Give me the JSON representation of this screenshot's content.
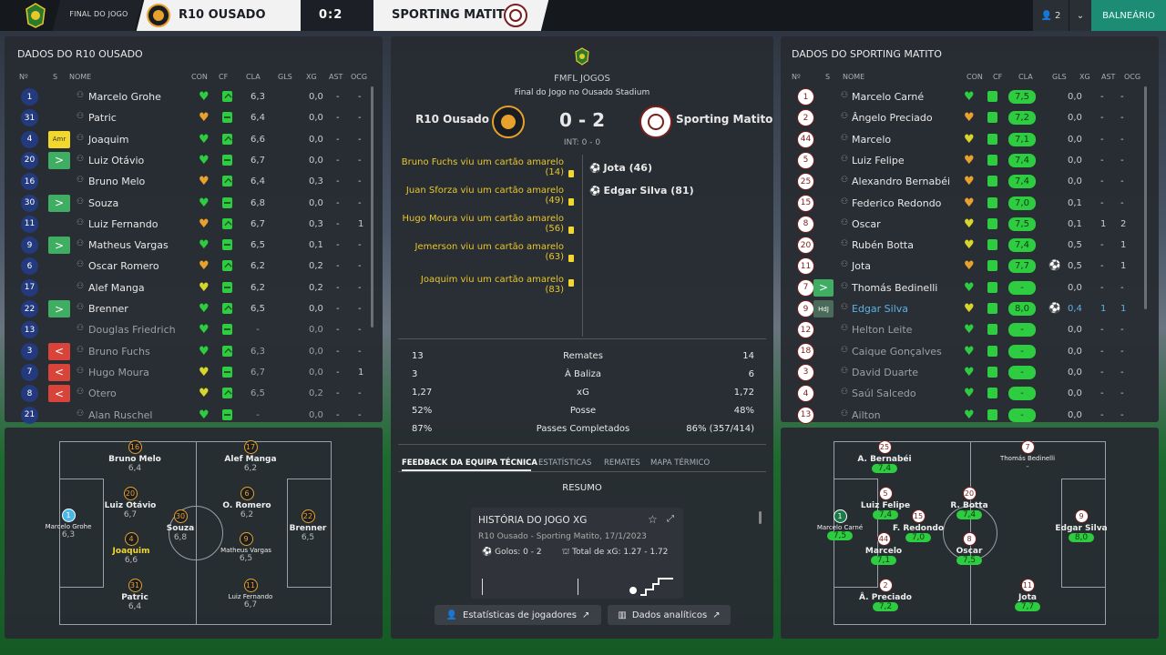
{
  "topbar": {
    "stage": "FINAL DO JOGO",
    "home": "R10 OUSADO",
    "score": "0:2",
    "away": "SPORTING MATITO",
    "users": "2",
    "right_button": "BALNEÁRIO"
  },
  "left": {
    "title": "DADOS DO R10 OUSADO",
    "headers": [
      "Nº",
      "S",
      "NOME",
      "CON",
      "CF",
      "CLA",
      "GLS",
      "XG",
      "AST",
      "OCG"
    ],
    "rows": [
      {
        "num": "1",
        "sub": "",
        "name": "Marcelo Grohe",
        "cla": "6,3",
        "xg": "0,0",
        "ast": "-",
        "ocg": "-"
      },
      {
        "num": "31",
        "sub": "",
        "name": "Patric",
        "cla": "6,4",
        "xg": "0,0",
        "ast": "-",
        "ocg": "-"
      },
      {
        "num": "4",
        "sub": "Amr",
        "name": "Joaquim",
        "cla": "6,6",
        "xg": "0,0",
        "ast": "-",
        "ocg": "-"
      },
      {
        "num": "20",
        "sub": ">",
        "name": "Luiz Otávio",
        "cla": "6,7",
        "xg": "0,0",
        "ast": "-",
        "ocg": "-"
      },
      {
        "num": "16",
        "sub": "",
        "name": "Bruno Melo",
        "cla": "6,4",
        "xg": "0,3",
        "ast": "-",
        "ocg": "-"
      },
      {
        "num": "30",
        "sub": ">",
        "name": "Souza",
        "cla": "6,8",
        "xg": "0,0",
        "ast": "-",
        "ocg": "-"
      },
      {
        "num": "11",
        "sub": "",
        "name": "Luiz Fernando",
        "cla": "6,7",
        "xg": "0,3",
        "ast": "-",
        "ocg": "1"
      },
      {
        "num": "9",
        "sub": ">",
        "name": "Matheus Vargas",
        "cla": "6,5",
        "xg": "0,1",
        "ast": "-",
        "ocg": "-"
      },
      {
        "num": "6",
        "sub": "",
        "name": "Oscar Romero",
        "cla": "6,2",
        "xg": "0,2",
        "ast": "-",
        "ocg": "-"
      },
      {
        "num": "17",
        "sub": "",
        "name": "Alef Manga",
        "cla": "6,2",
        "xg": "0,2",
        "ast": "-",
        "ocg": "-"
      },
      {
        "num": "22",
        "sub": ">",
        "name": "Brenner",
        "cla": "6,5",
        "xg": "0,0",
        "ast": "-",
        "ocg": "-"
      },
      {
        "num": "13",
        "sub": "",
        "name": "Douglas Friedrich",
        "cla": "-",
        "xg": "0,0",
        "ast": "-",
        "ocg": "-"
      },
      {
        "num": "3",
        "sub": "<",
        "name": "Bruno Fuchs",
        "cla": "6,3",
        "xg": "0,0",
        "ast": "-",
        "ocg": "-"
      },
      {
        "num": "7",
        "sub": "<",
        "name": "Hugo Moura",
        "cla": "6,7",
        "xg": "0,0",
        "ast": "-",
        "ocg": "1"
      },
      {
        "num": "8",
        "sub": "<",
        "name": "Otero",
        "cla": "6,5",
        "xg": "0,2",
        "ast": "-",
        "ocg": "-"
      },
      {
        "num": "21",
        "sub": "",
        "name": "Alan Ruschel",
        "cla": "-",
        "xg": "0,0",
        "ast": "-",
        "ocg": "-"
      }
    ],
    "pitch": [
      {
        "num": "1",
        "name": "Marcelo Grohe",
        "rating": "6,3"
      },
      {
        "num": "16",
        "name": "Bruno Melo",
        "rating": "6,4"
      },
      {
        "num": "17",
        "name": "Alef Manga",
        "rating": "6,2"
      },
      {
        "num": "20",
        "name": "Luiz Otávio",
        "rating": "6,7"
      },
      {
        "num": "6",
        "name": "O. Romero",
        "rating": "6,2"
      },
      {
        "num": "30",
        "name": "Souza",
        "rating": "6,8"
      },
      {
        "num": "22",
        "name": "Brenner",
        "rating": "6,5"
      },
      {
        "num": "4",
        "name": "Joaquim",
        "rating": "6,6"
      },
      {
        "num": "9",
        "name": "Matheus Vargas",
        "rating": "6,5"
      },
      {
        "num": "31",
        "name": "Patric",
        "rating": "6,4"
      },
      {
        "num": "11",
        "name": "Luiz Fernando",
        "rating": "6,7"
      }
    ]
  },
  "right": {
    "title": "DADOS DO SPORTING MATITO",
    "headers": [
      "Nº",
      "S",
      "NOME",
      "CON",
      "CF",
      "CLA",
      "GLS",
      "XG",
      "AST",
      "OCG"
    ],
    "rows": [
      {
        "num": "1",
        "sub": "",
        "name": "Marcelo Carné",
        "cla": "7,5",
        "goal": "",
        "xg": "0,0",
        "ast": "-",
        "ocg": "-"
      },
      {
        "num": "2",
        "sub": "",
        "name": "Ângelo Preciado",
        "cla": "7,2",
        "goal": "",
        "xg": "0,0",
        "ast": "-",
        "ocg": "-"
      },
      {
        "num": "44",
        "sub": "",
        "name": "Marcelo",
        "cla": "7,1",
        "goal": "",
        "xg": "0,0",
        "ast": "-",
        "ocg": "-"
      },
      {
        "num": "5",
        "sub": "",
        "name": "Luiz Felipe",
        "cla": "7,4",
        "goal": "",
        "xg": "0,0",
        "ast": "-",
        "ocg": "-"
      },
      {
        "num": "25",
        "sub": "",
        "name": "Alexandro Bernabéi",
        "cla": "7,4",
        "goal": "",
        "xg": "0,0",
        "ast": "-",
        "ocg": "-"
      },
      {
        "num": "15",
        "sub": "",
        "name": "Federico Redondo",
        "cla": "7,0",
        "goal": "",
        "xg": "0,1",
        "ast": "-",
        "ocg": "-"
      },
      {
        "num": "8",
        "sub": "",
        "name": "Oscar",
        "cla": "7,5",
        "goal": "",
        "xg": "0,1",
        "ast": "1",
        "ocg": "2"
      },
      {
        "num": "20",
        "sub": "",
        "name": "Rubén Botta",
        "cla": "7,4",
        "goal": "",
        "xg": "0,5",
        "ast": "-",
        "ocg": "1"
      },
      {
        "num": "11",
        "sub": "",
        "name": "Jota",
        "cla": "7,7",
        "goal": "⚽",
        "xg": "0,5",
        "ast": "-",
        "ocg": "1"
      },
      {
        "num": "7",
        "sub": ">",
        "name": "Thomás Bedinelli",
        "cla": "-",
        "goal": "",
        "xg": "0,0",
        "ast": "-",
        "ocg": "-"
      },
      {
        "num": "9",
        "sub": "HdJ",
        "name": "Edgar Silva",
        "cla": "8,0",
        "goal": "⚽",
        "xg": "0,4",
        "ast": "1",
        "ocg": "1"
      },
      {
        "num": "12",
        "sub": "",
        "name": "Helton Leite",
        "cla": "-",
        "goal": "",
        "xg": "0,0",
        "ast": "-",
        "ocg": "-"
      },
      {
        "num": "18",
        "sub": "",
        "name": "Caique Gonçalves",
        "cla": "-",
        "goal": "",
        "xg": "0,0",
        "ast": "-",
        "ocg": "-"
      },
      {
        "num": "3",
        "sub": "",
        "name": "David Duarte",
        "cla": "-",
        "goal": "",
        "xg": "0,0",
        "ast": "-",
        "ocg": "-"
      },
      {
        "num": "4",
        "sub": "",
        "name": "Saúl Salcedo",
        "cla": "-",
        "goal": "",
        "xg": "0,0",
        "ast": "-",
        "ocg": "-"
      },
      {
        "num": "13",
        "sub": "",
        "name": "Ailton",
        "cla": "-",
        "goal": "",
        "xg": "0,0",
        "ast": "-",
        "ocg": "-"
      }
    ],
    "pitch": [
      {
        "num": "25",
        "name": "A. Bernabéi",
        "rating": "7,4"
      },
      {
        "num": "7",
        "name": "Thomás Bedinelli",
        "rating": "-"
      },
      {
        "num": "5",
        "name": "Luiz Felipe",
        "rating": "7,4"
      },
      {
        "num": "20",
        "name": "R. Botta",
        "rating": "7,4"
      },
      {
        "num": "1",
        "name": "Marcelo Carné",
        "rating": "7,5"
      },
      {
        "num": "15",
        "name": "F. Redondo",
        "rating": "7,0"
      },
      {
        "num": "9",
        "name": "Edgar Silva",
        "rating": "8,0"
      },
      {
        "num": "44",
        "name": "Marcelo",
        "rating": "7,1"
      },
      {
        "num": "8",
        "name": "Oscar",
        "rating": "7,5"
      },
      {
        "num": "2",
        "name": "Â. Preciado",
        "rating": "7,2"
      },
      {
        "num": "11",
        "name": "Jota",
        "rating": "7,7"
      }
    ]
  },
  "center": {
    "competition": "FMFL JOGOS",
    "venue": "Final do Jogo no Ousado Stadium",
    "home": "R10 Ousado",
    "away": "Sporting Matito",
    "score": "0 - 2",
    "interval": "INT: 0 - 0",
    "home_events": [
      "Bruno Fuchs viu um cartão amarelo (14)",
      "Juan Sforza viu um cartão amarelo (49)",
      "Hugo Moura viu um cartão amarelo (56)",
      "Jemerson viu um cartão amarelo (63)",
      "Joaquim viu um cartão amarelo (83)"
    ],
    "away_events": [
      "Jota (46)",
      "Edgar Silva (81)"
    ],
    "stats": [
      {
        "home": "13",
        "label": "Remates",
        "away": "14"
      },
      {
        "home": "3",
        "label": "À Baliza",
        "away": "6"
      },
      {
        "home": "1,27",
        "label": "xG",
        "away": "1,72"
      },
      {
        "home": "52%",
        "label": "Posse",
        "away": "48%"
      },
      {
        "home": "87%",
        "label": "Passes Completados",
        "away": "86% (357/414)"
      }
    ],
    "tabs": [
      "FEEDBACK DA EQUIPA TÉCNICA",
      "ESTATÍSTICAS",
      "REMATES",
      "MAPA TÉRMICO"
    ],
    "summary": "RESUMO",
    "card_title": "HISTÓRIA DO JOGO XG",
    "card_sub": "R10 Ousado - Sporting Matito, 17/1/2023",
    "card_goals": "Golos: 0 - 2",
    "card_xg": "Total de xG: 1.27 - 1.72",
    "btn_players": "Estatísticas de jogadores",
    "btn_analytics": "Dados analíticos"
  },
  "colors": {
    "home_num": "#243a7e",
    "sub_in": "#3fae62",
    "sub_out": "#d9443a",
    "yellow": "#f2d72c",
    "green": "#2ecc40",
    "teal": "#1c8c74"
  }
}
